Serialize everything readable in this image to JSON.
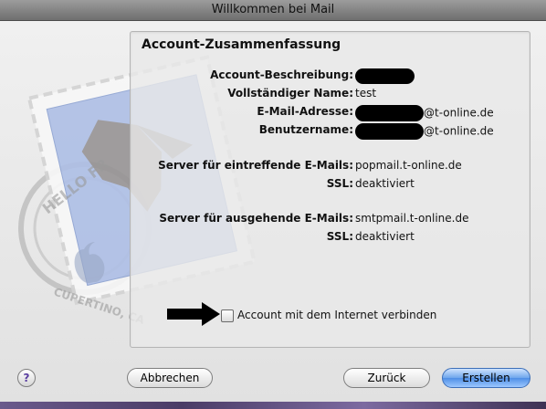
{
  "window": {
    "title": "Willkommen bei Mail"
  },
  "summary": {
    "heading": "Account-Zusammenfassung",
    "rows": [
      {
        "label": "Account-Beschreibung:",
        "value": ""
      },
      {
        "label": "Vollständiger Name:",
        "value": "test"
      },
      {
        "label": "E-Mail-Adresse:",
        "value": "@t-online.de"
      },
      {
        "label": "Benutzername:",
        "value": "@t-online.de"
      },
      {
        "label": "Server für eintreffende E-Mails:",
        "value": "popmail.t-online.de"
      },
      {
        "label": "SSL:",
        "value": "deaktiviert"
      },
      {
        "label": "Server für ausgehende E-Mails:",
        "value": "smtpmail.t-online.de"
      },
      {
        "label": "SSL:",
        "value": "deaktiviert"
      }
    ],
    "connect_label": "Account mit dem Internet verbinden",
    "connect_checked": false
  },
  "buttons": {
    "help": "?",
    "cancel": "Abbrechen",
    "back": "Zurück",
    "create": "Erstellen"
  },
  "stamp": {
    "text_top": "HELLO FR",
    "text_bottom": "CUPERTINO, CA"
  },
  "colors": {
    "default_button": "#5b97e8",
    "stamp_blue": "#aabfe6"
  }
}
